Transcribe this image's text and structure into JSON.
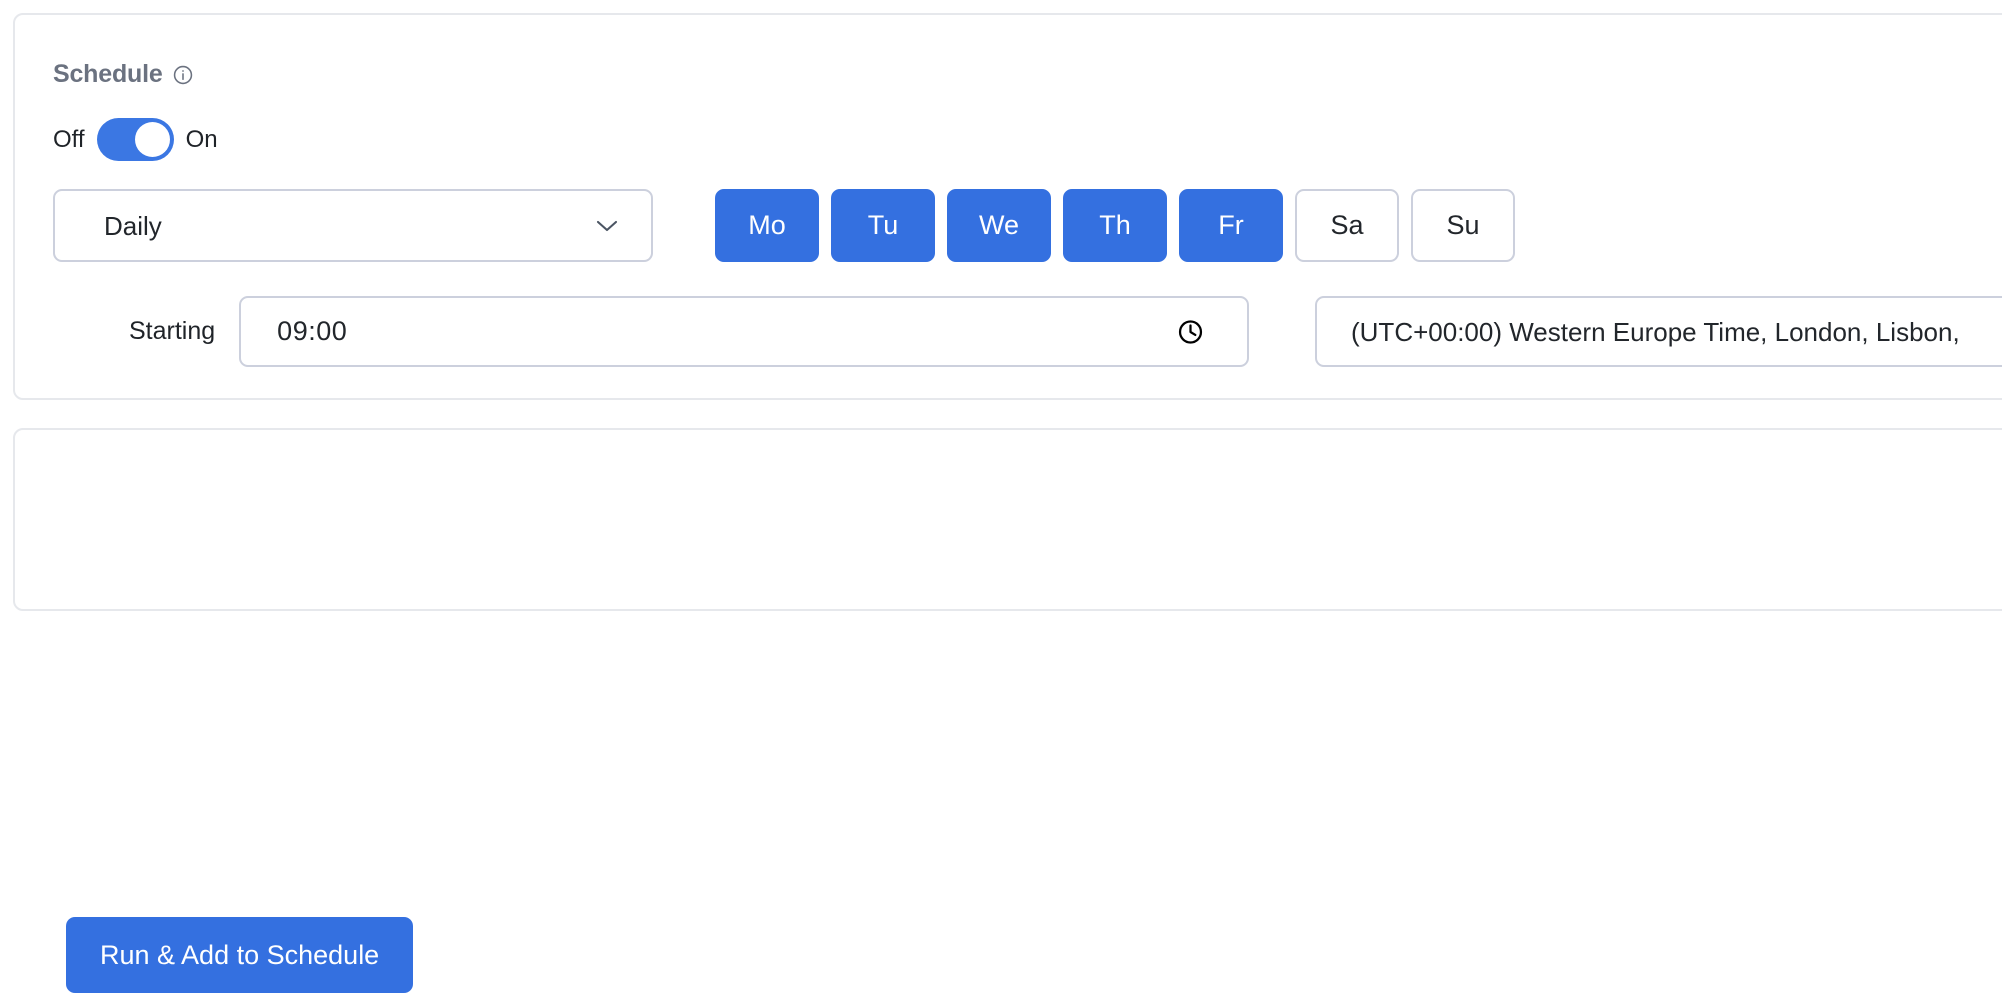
{
  "schedule_card": {
    "title": "Schedule",
    "info_icon": "info-circle-icon",
    "toggle": {
      "off_label": "Off",
      "on_label": "On",
      "state": "on"
    },
    "frequency": {
      "selected": "Daily",
      "chevron_icon": "chevron-down-icon"
    },
    "days": [
      {
        "label": "Mo",
        "selected": true
      },
      {
        "label": "Tu",
        "selected": true
      },
      {
        "label": "We",
        "selected": true
      },
      {
        "label": "Th",
        "selected": true
      },
      {
        "label": "Fr",
        "selected": true
      },
      {
        "label": "Sa",
        "selected": false
      },
      {
        "label": "Su",
        "selected": false
      }
    ],
    "starting": {
      "label": "Starting",
      "time_value": "09:00",
      "clock_icon": "clock-icon"
    },
    "timezone": {
      "value": "(UTC+00:00) Western Europe Time, London, Lisbon,"
    }
  },
  "actions_card": {
    "run_button_label": "Run & Add to Schedule"
  },
  "colors": {
    "accent_blue": "#3470e0",
    "toggle_blue": "#3b77e3",
    "card_border": "#e6e8ec",
    "field_border": "#ccd0dd",
    "title_gray": "#6b7280",
    "text_dark": "#22262b"
  }
}
